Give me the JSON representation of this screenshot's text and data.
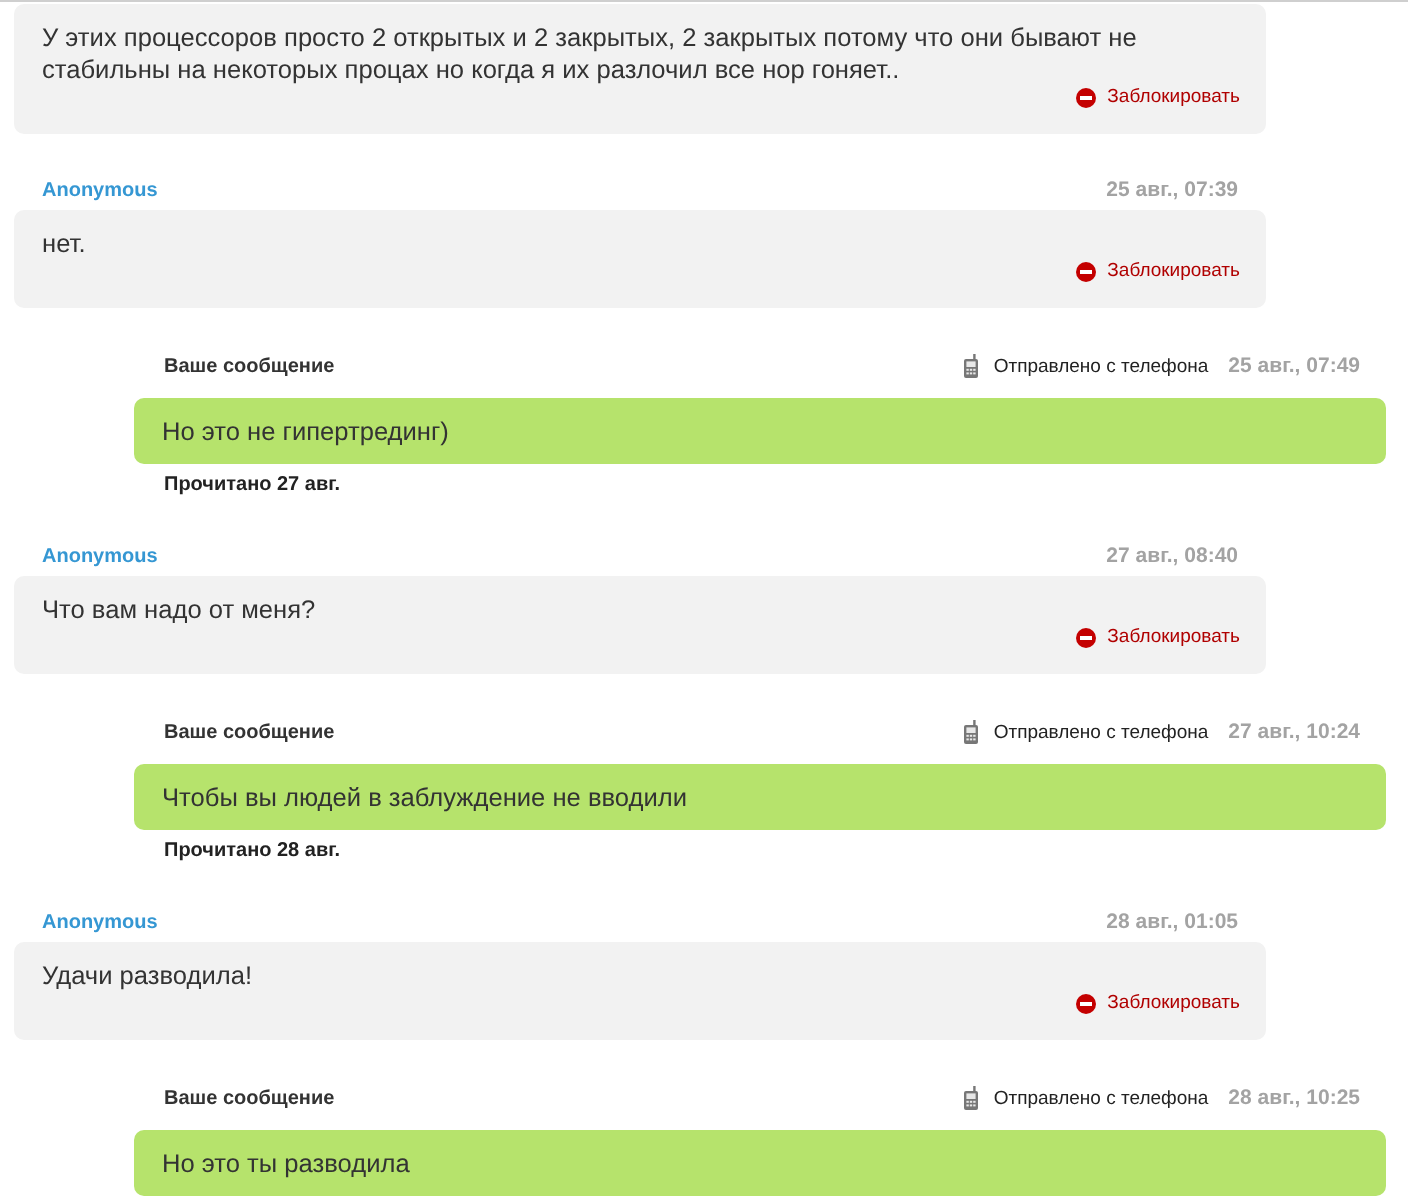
{
  "messages": [
    {
      "kind": "incoming",
      "text": "У этих процессоров просто 2 открытых и 2 закрытых, 2 закрытых потому что они бывают не стабильны на некоторых процах но когда я их разлочил все нор гоняет..",
      "action": "Заблокировать"
    },
    {
      "kind": "incoming",
      "author": "Anonymous",
      "time": "25 авг., 07:39",
      "text": "нет.",
      "action": "Заблокировать"
    },
    {
      "kind": "outgoing",
      "label": "Ваше сообщение",
      "sent_via": "Отправлено с телефона",
      "time": "25 авг., 07:49",
      "text": "Но это не гипертрединг)",
      "read_status": "Прочитано 27 авг."
    },
    {
      "kind": "incoming",
      "author": "Anonymous",
      "time": "27 авг., 08:40",
      "text": "Что вам надо от меня?",
      "action": "Заблокировать"
    },
    {
      "kind": "outgoing",
      "label": "Ваше сообщение",
      "sent_via": "Отправлено с телефона",
      "time": "27 авг., 10:24",
      "text": "Чтобы вы людей в заблуждение не вводили",
      "read_status": "Прочитано 28 авг."
    },
    {
      "kind": "incoming",
      "author": "Anonymous",
      "time": "28 авг., 01:05",
      "text": "Удачи разводила!",
      "action": "Заблокировать"
    },
    {
      "kind": "outgoing",
      "label": "Ваше сообщение",
      "sent_via": "Отправлено с телефона",
      "time": "28 авг., 10:25",
      "text": "Но это ты разводила"
    }
  ]
}
